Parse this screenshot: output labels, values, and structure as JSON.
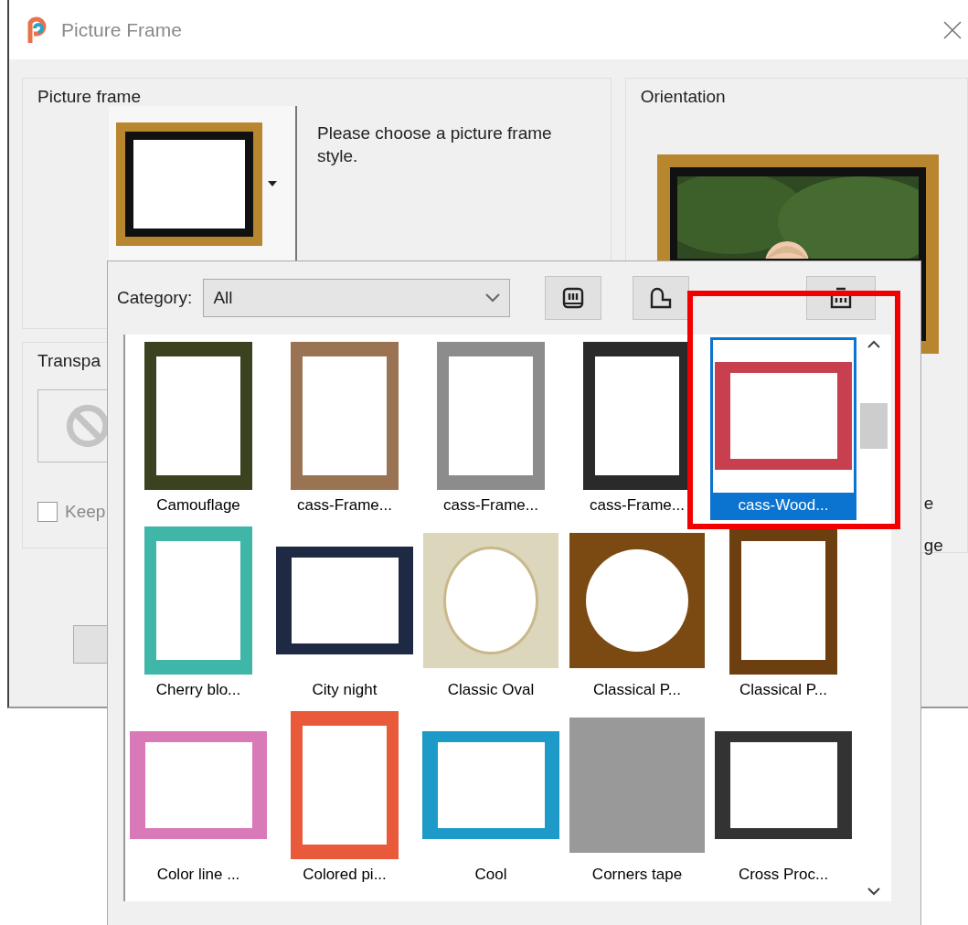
{
  "window": {
    "title": "Picture Frame"
  },
  "picture_frame_group": {
    "title": "Picture frame",
    "hint": "Please choose a picture frame style."
  },
  "transparency_group": {
    "title": "Transpa",
    "keep": {
      "label": "Keep",
      "checked": false
    }
  },
  "orientation_group": {
    "title": "Orientation",
    "option_1": "e",
    "option_2": "ge"
  },
  "frame_picker": {
    "category_label": "Category:",
    "category": "All",
    "frames": [
      {
        "name": "Camouflage",
        "kind": "portrait",
        "color": "#3b4220",
        "selected": false
      },
      {
        "name": "cass-Frame...",
        "kind": "portrait",
        "color": "#9a7452",
        "selected": false
      },
      {
        "name": "cass-Frame...",
        "kind": "portrait",
        "color": "#8c8c8c",
        "selected": false
      },
      {
        "name": "cass-Frame...",
        "kind": "portrait",
        "color": "#2a2a2a",
        "selected": false
      },
      {
        "name": "cass-Wood...",
        "kind": "landscape",
        "color": "#c8404f",
        "selected": true
      },
      {
        "name": "Cherry blo...",
        "kind": "portrait",
        "color": "#3fb6a8",
        "selected": false
      },
      {
        "name": "City night",
        "kind": "landscape",
        "color": "#1e2a44",
        "selected": false
      },
      {
        "name": "Classic Oval",
        "kind": "oval",
        "color": "#dcd6bc",
        "selected": false
      },
      {
        "name": "Classical P...",
        "kind": "round",
        "color": "#7a4a12",
        "selected": false
      },
      {
        "name": "Classical P...",
        "kind": "portrait",
        "color": "#6b3f10",
        "selected": false
      },
      {
        "name": "Color line ...",
        "kind": "landscape",
        "color": "#d979b8",
        "selected": false
      },
      {
        "name": "Colored pi...",
        "kind": "portrait",
        "color": "#e85a3a",
        "selected": false
      },
      {
        "name": "Cool",
        "kind": "landscape",
        "color": "#1e9ac8",
        "selected": false
      },
      {
        "name": "Corners tape",
        "kind": "filled",
        "color": "#999999",
        "selected": false
      },
      {
        "name": "Cross Proc...",
        "kind": "landscape",
        "color": "#333333",
        "selected": false
      }
    ]
  }
}
